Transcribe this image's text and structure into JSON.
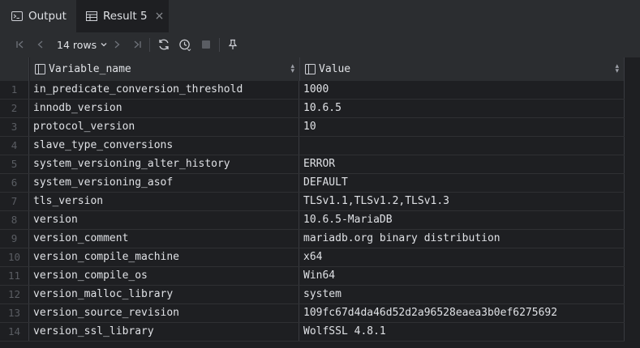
{
  "tabs": [
    {
      "label": "Output",
      "icon": "console-icon"
    },
    {
      "label": "Result 5",
      "icon": "table-icon",
      "close": "×"
    }
  ],
  "toolbar": {
    "rows_label": "14 rows"
  },
  "table": {
    "columns": [
      "Variable_name",
      "Value"
    ],
    "rows": [
      {
        "n": "1",
        "name": "in_predicate_conversion_threshold",
        "value": "1000"
      },
      {
        "n": "2",
        "name": "innodb_version",
        "value": "10.6.5"
      },
      {
        "n": "3",
        "name": "protocol_version",
        "value": "10"
      },
      {
        "n": "4",
        "name": "slave_type_conversions",
        "value": ""
      },
      {
        "n": "5",
        "name": "system_versioning_alter_history",
        "value": "ERROR"
      },
      {
        "n": "6",
        "name": "system_versioning_asof",
        "value": "DEFAULT"
      },
      {
        "n": "7",
        "name": "tls_version",
        "value": "TLSv1.1,TLSv1.2,TLSv1.3"
      },
      {
        "n": "8",
        "name": "version",
        "value": "10.6.5-MariaDB"
      },
      {
        "n": "9",
        "name": "version_comment",
        "value": "mariadb.org binary distribution"
      },
      {
        "n": "10",
        "name": "version_compile_machine",
        "value": "x64"
      },
      {
        "n": "11",
        "name": "version_compile_os",
        "value": "Win64"
      },
      {
        "n": "12",
        "name": "version_malloc_library",
        "value": "system"
      },
      {
        "n": "13",
        "name": "version_source_revision",
        "value": "109fc67d4da46d52d2a96528eaea3b0ef6275692"
      },
      {
        "n": "14",
        "name": "version_ssl_library",
        "value": "WolfSSL 4.8.1"
      }
    ]
  }
}
